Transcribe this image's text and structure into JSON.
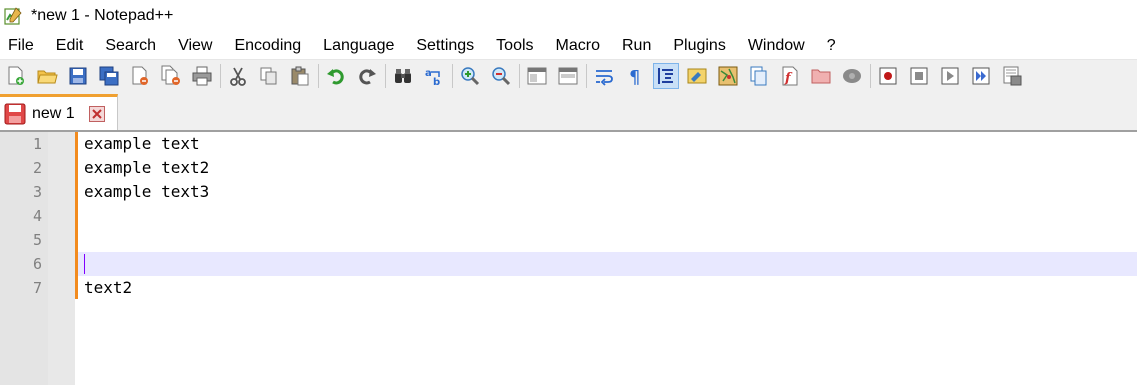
{
  "window": {
    "title": "*new 1 - Notepad++"
  },
  "menu": [
    "File",
    "Edit",
    "Search",
    "View",
    "Encoding",
    "Language",
    "Settings",
    "Tools",
    "Macro",
    "Run",
    "Plugins",
    "Window",
    "?"
  ],
  "tab": {
    "label": "new 1",
    "modified": true
  },
  "editor": {
    "line_numbers": [
      "1",
      "2",
      "3",
      "4",
      "5",
      "6",
      "7"
    ],
    "lines": [
      "example text",
      "example text2",
      "example text3",
      "",
      "",
      "",
      "text2"
    ],
    "current_line": 6
  },
  "colors": {
    "change_marker": "#f28b1e",
    "current_line_bg": "#e8e8ff",
    "caret": "#8000ff",
    "line_number_text": "#808080"
  }
}
